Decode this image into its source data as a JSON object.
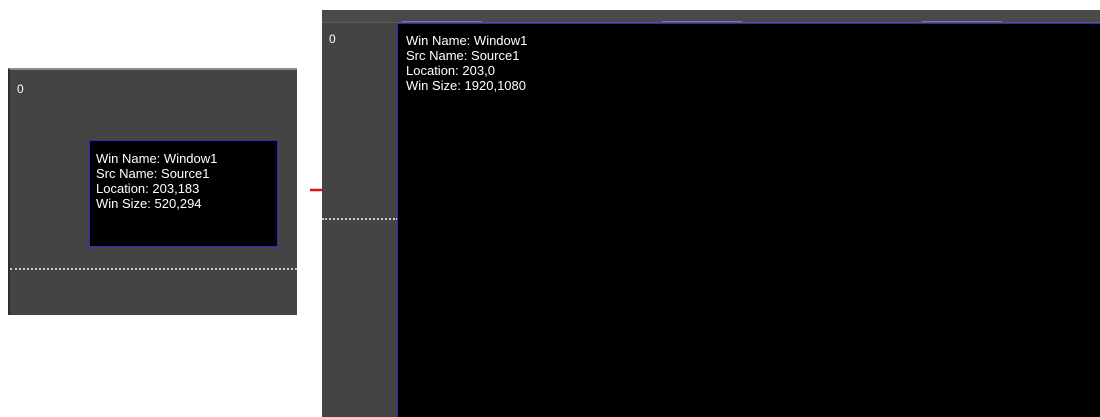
{
  "before": {
    "screen_index": "0",
    "window": {
      "win_name_label": "Win Name:",
      "win_name": "Window1",
      "src_name_label": "Src Name:",
      "src_name": "Source1",
      "location_label": "Location:",
      "location": "203,183",
      "win_size_label": "Win Size:",
      "win_size": "520,294"
    }
  },
  "after": {
    "screen_index": "0",
    "window": {
      "win_name_label": "Win Name:",
      "win_name": "Window1",
      "src_name_label": "Src Name:",
      "src_name": "Source1",
      "location_label": "Location:",
      "location": "203,0",
      "win_size_label": "Win Size:",
      "win_size": "1920,1080"
    }
  },
  "colors": {
    "panel_bg": "#444444",
    "window_bg": "#000000",
    "window_border": "#2a2ad0",
    "arrow": "#e01010",
    "text": "#ffffff"
  },
  "icons": {
    "transition_arrow": "right-arrow-icon"
  }
}
